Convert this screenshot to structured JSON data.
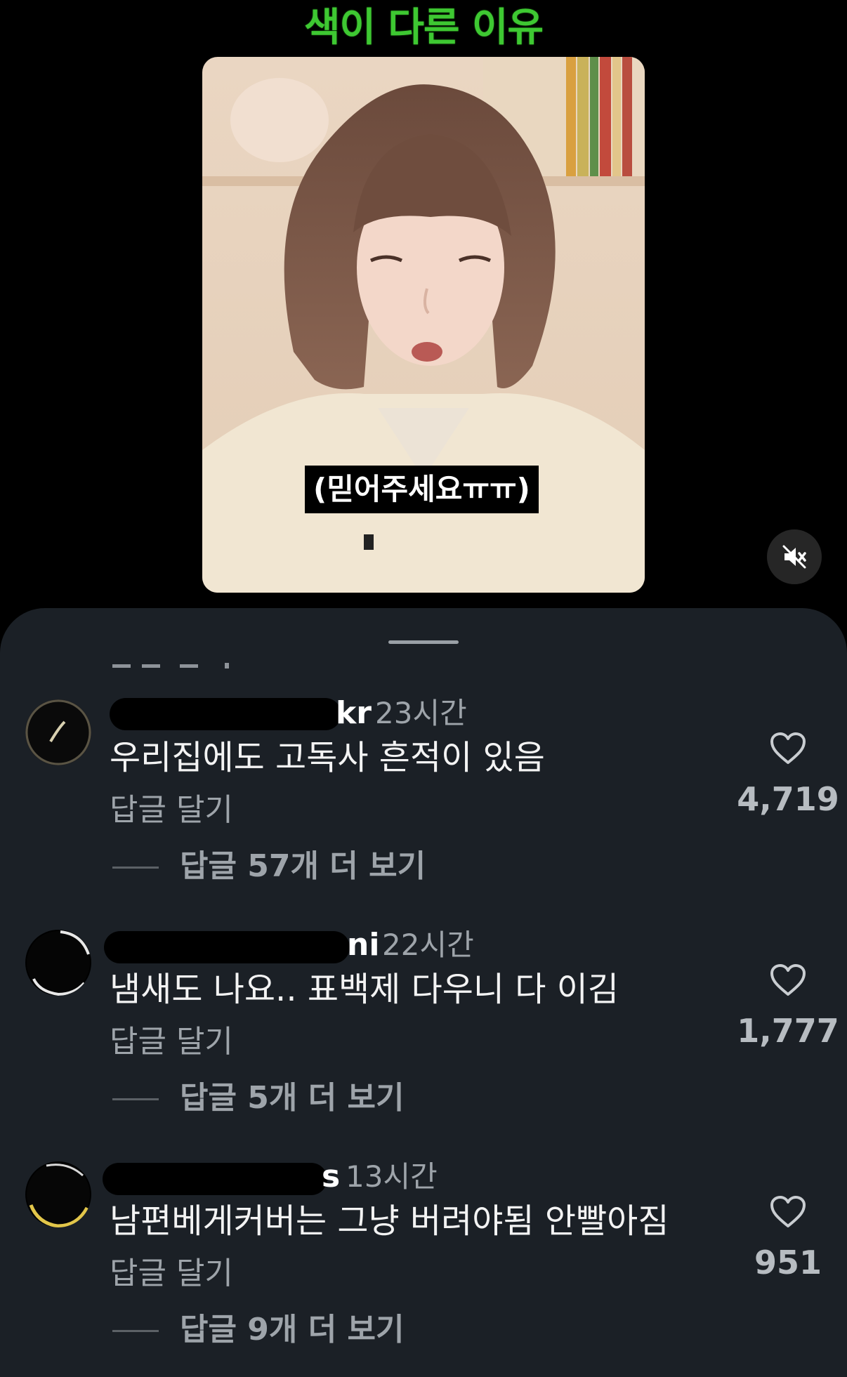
{
  "video": {
    "title_overlay": "색이 다른 이유",
    "subtitle": "(믿어주세요ㅠㅠ)",
    "mute_icon": "speaker-muted-icon"
  },
  "colors": {
    "title_green": "#3ec832",
    "sheet_background": "#1b2026",
    "secondary_text": "#9ea4aa"
  },
  "comments": [
    {
      "username_visible": "kr",
      "time": "23시간",
      "text": "우리집에도 고독사 흔적이 있음",
      "reply_label": "답글 달기",
      "more_replies": "답글 57개 더 보기",
      "likes": "4,719"
    },
    {
      "username_visible": "ni",
      "time": "22시간",
      "text": "냄새도 나요.. 표백제 다우니 다 이김",
      "reply_label": "답글 달기",
      "more_replies": "답글 5개 더 보기",
      "likes": "1,777"
    },
    {
      "username_visible": "s",
      "time": "13시간",
      "text": "남편베게커버는 그냥 버려야됨 안빨아짐",
      "reply_label": "답글 달기",
      "more_replies": "답글 9개 더 보기",
      "likes": "951"
    }
  ]
}
